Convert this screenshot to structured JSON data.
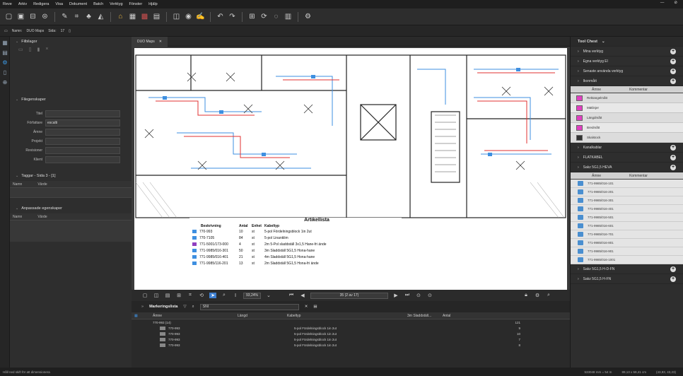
{
  "menubar": {
    "items": [
      "Reve",
      "Arkiv",
      "Redigera",
      "Visa",
      "Dokument",
      "Batch",
      "Verktyg",
      "Fönster",
      "Hjälp"
    ]
  },
  "window": {
    "minimize": "—",
    "close": "⊘"
  },
  "docbar": {
    "name_label": "Namn:",
    "name_value": "DUO Maps",
    "size_label": "Sida:",
    "size_value": "17"
  },
  "left": {
    "files_title": "Filbilagor",
    "props_title": "Filegenskaper",
    "props": [
      {
        "key": "Titel",
        "value": ""
      },
      {
        "key": "Författare",
        "value": "escalti"
      },
      {
        "key": "Ämne",
        "value": ""
      },
      {
        "key": "Projekt",
        "value": ""
      },
      {
        "key": "Revisioner",
        "value": ""
      },
      {
        "key": "Klient",
        "value": ""
      }
    ],
    "tags_title": "Taggar - Sida 3 - [1]",
    "tags_cols": [
      "Namn",
      "Värde"
    ],
    "custom_title": "Anpassade egenskaper",
    "custom_cols": [
      "Namn",
      "Värde"
    ]
  },
  "doc": {
    "tab_title": "DUO Maps",
    "tab_close": "✕"
  },
  "articles": {
    "title": "Artikellista",
    "headers": [
      "Beskrivning",
      "Antal",
      "Enhet",
      "Kabeltyp"
    ],
    "rows": [
      {
        "desc": "770-993",
        "qty": "10",
        "unit": "st",
        "cable": "5-pol Fördelningsblock 1in 2ut",
        "color": "#3e8fe0"
      },
      {
        "desc": "770-7105",
        "qty": "84",
        "unit": "st",
        "cable": "5-pol Linanklim",
        "color": "#3e8fe0"
      },
      {
        "desc": "771-5001/173-000",
        "qty": "4",
        "unit": "st",
        "cable": "2m 5-Pol sladdställ 3x1,5 Hane-fri ände",
        "color": "#8f3ec0"
      },
      {
        "desc": "771-9985/016-301",
        "qty": "50",
        "unit": "st",
        "cable": "3m Sladdställ 5G1,5 Hona-hane",
        "color": "#3e8fe0"
      },
      {
        "desc": "771-9985/016-401",
        "qty": "21",
        "unit": "st",
        "cable": "4m Sladdställ 5G1,5 Hona-hane",
        "color": "#3e8fe0"
      },
      {
        "desc": "771-9985/116-201",
        "qty": "13",
        "unit": "st",
        "cable": "2m Sladdställ 5G1,5 Hona-fri ände",
        "color": "#3e8fe0"
      }
    ]
  },
  "nav": {
    "zoom": "93,24%",
    "page": "35 (2 av 17)"
  },
  "marklist": {
    "title": "Markeringslista",
    "search": "SNI",
    "headers": [
      "Ämne",
      "Längd",
      "Kabeltyp",
      "3m Sladdställ...",
      "Antal"
    ],
    "group": {
      "label": "770-993 (14)",
      "count": "121"
    },
    "rows": [
      {
        "name": "770-993",
        "cable": "5-pol Fördelningsblock 1in 2ut",
        "qty": "9"
      },
      {
        "name": "770-993",
        "cable": "5-pol Fördelningsblock 1in 2ut",
        "qty": "10"
      },
      {
        "name": "770-993",
        "cable": "5-pol Fördelningsblock 1in 2ut",
        "qty": "7"
      },
      {
        "name": "770-993",
        "cable": "5-pol Fördelningsblock 1in 2ut",
        "qty": "8"
      }
    ]
  },
  "right": {
    "title": "Tool Chest",
    "sections": [
      "Mina verktyg",
      "Egna verktyg El",
      "Senaste använda verktyg",
      "Ikonmått"
    ],
    "tool_cols": [
      "Ämne",
      "Kommentar"
    ],
    "tools": [
      {
        "name": "Rektangelmått",
        "color": "#e040c0"
      },
      {
        "name": "Mätlinjer",
        "color": "#e040c0"
      },
      {
        "name": "Längdmått",
        "color": "#e040c0"
      },
      {
        "name": "Bredmått",
        "color": "#e040c0"
      },
      {
        "name": "Skalstock",
        "color": "#333333"
      }
    ],
    "sections2": [
      "Kanalkablar",
      "FLATKABEL",
      "Sakz 5G1,5 HEVA"
    ],
    "parts_cols": [
      "Ämne",
      "Kommentar"
    ],
    "parts": [
      "771-9985/016-101",
      "771-9985/016-201",
      "771-9985/016-301",
      "771-9985/016-401",
      "771-9985/016-501",
      "771-9985/016-601",
      "771-9985/016-701",
      "771-9985/016-801",
      "771-9985/016-901",
      "771-9985/016-1001"
    ],
    "sections3": [
      "Sakz 5G1,5 H-D-FN",
      "Sakz 5G1,5 H-FN"
    ]
  },
  "status": {
    "left": "Håll ned skift för att dimensionera",
    "coords": "533048 mm = 54 m",
    "size": "89,13 x 59,41 cm",
    "pos": "(43,93, 43,23)"
  }
}
